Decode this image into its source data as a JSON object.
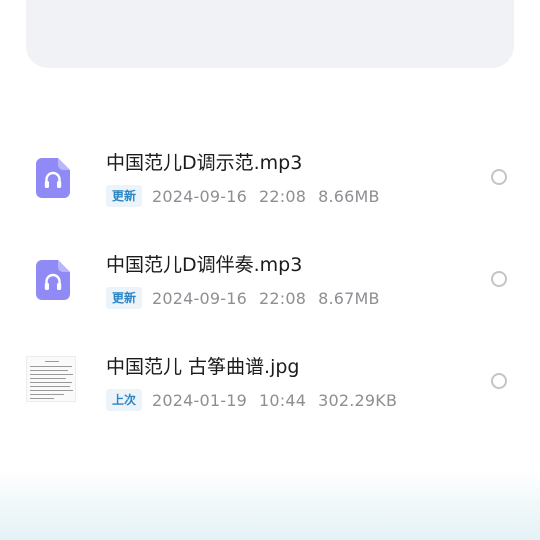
{
  "files": [
    {
      "name": "中国范儿D调示范.mp3",
      "badge": "更新",
      "date": "2024-09-16",
      "time": "22:08",
      "size": "8.66MB",
      "icon": "headphones-file-icon",
      "icon_color": "#8f8af5"
    },
    {
      "name": "中国范儿D调伴奏.mp3",
      "badge": "更新",
      "date": "2024-09-16",
      "time": "22:08",
      "size": "8.67MB",
      "icon": "headphones-file-icon",
      "icon_color": "#8f8af5"
    },
    {
      "name": "中国范儿 古筝曲谱.jpg",
      "badge": "上次",
      "date": "2024-01-19",
      "time": "10:44",
      "size": "302.29KB",
      "icon": "image-thumbnail"
    }
  ],
  "colors": {
    "badge_text": "#2b86c6",
    "badge_bg": "#ecf4fa",
    "meta_text": "#8e8e93",
    "radio_border": "#c4c4c8",
    "top_card": "#f1f2f6"
  }
}
